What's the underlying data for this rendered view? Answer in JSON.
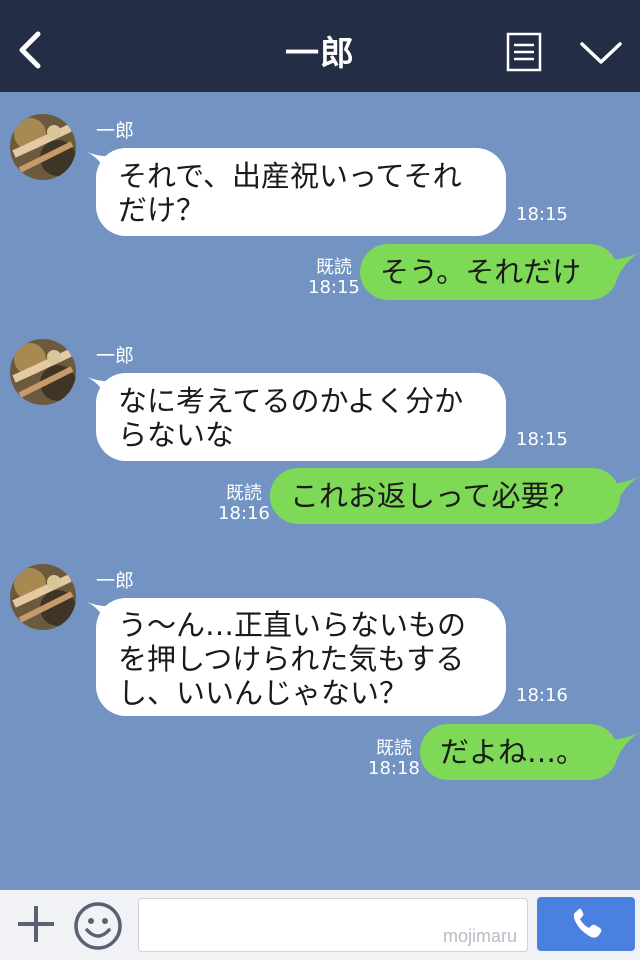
{
  "header": {
    "title": "一郎",
    "back_icon": "chevron-left-icon",
    "menu_icon": "menu-list-icon",
    "expand_icon": "chevron-down-icon"
  },
  "colors": {
    "header_bg": "#232d46",
    "chat_bg": "#7393c3",
    "incoming_bubble": "#ffffff",
    "outgoing_bubble": "#7ed957",
    "call_button": "#4a80e0"
  },
  "messages": [
    {
      "dir": "in",
      "sender": "一郎",
      "lines": [
        "それで、出産祝いってそれ",
        "だけ？"
      ],
      "time": "18:15"
    },
    {
      "dir": "out",
      "read": "既読",
      "time": "18:15",
      "lines": [
        "そう。それだけ"
      ]
    },
    {
      "dir": "in",
      "sender": "一郎",
      "lines": [
        "なに考えてるのかよく分か",
        "らないな"
      ],
      "time": "18:15"
    },
    {
      "dir": "out",
      "read": "既読",
      "time": "18:16",
      "lines": [
        "これお返しって必要？"
      ]
    },
    {
      "dir": "in",
      "sender": "一郎",
      "lines": [
        "う～ん…正直いらないもの",
        "を押しつけられた気もする",
        "し、いいんじゃない？"
      ],
      "time": "18:16"
    },
    {
      "dir": "out",
      "read": "既読",
      "time": "18:18",
      "lines": [
        "だよね…。"
      ]
    }
  ],
  "footer": {
    "plus_icon": "plus-icon",
    "sticker_icon": "smiley-icon",
    "input_value": "",
    "watermark": "mojimaru",
    "call_icon": "phone-icon"
  }
}
